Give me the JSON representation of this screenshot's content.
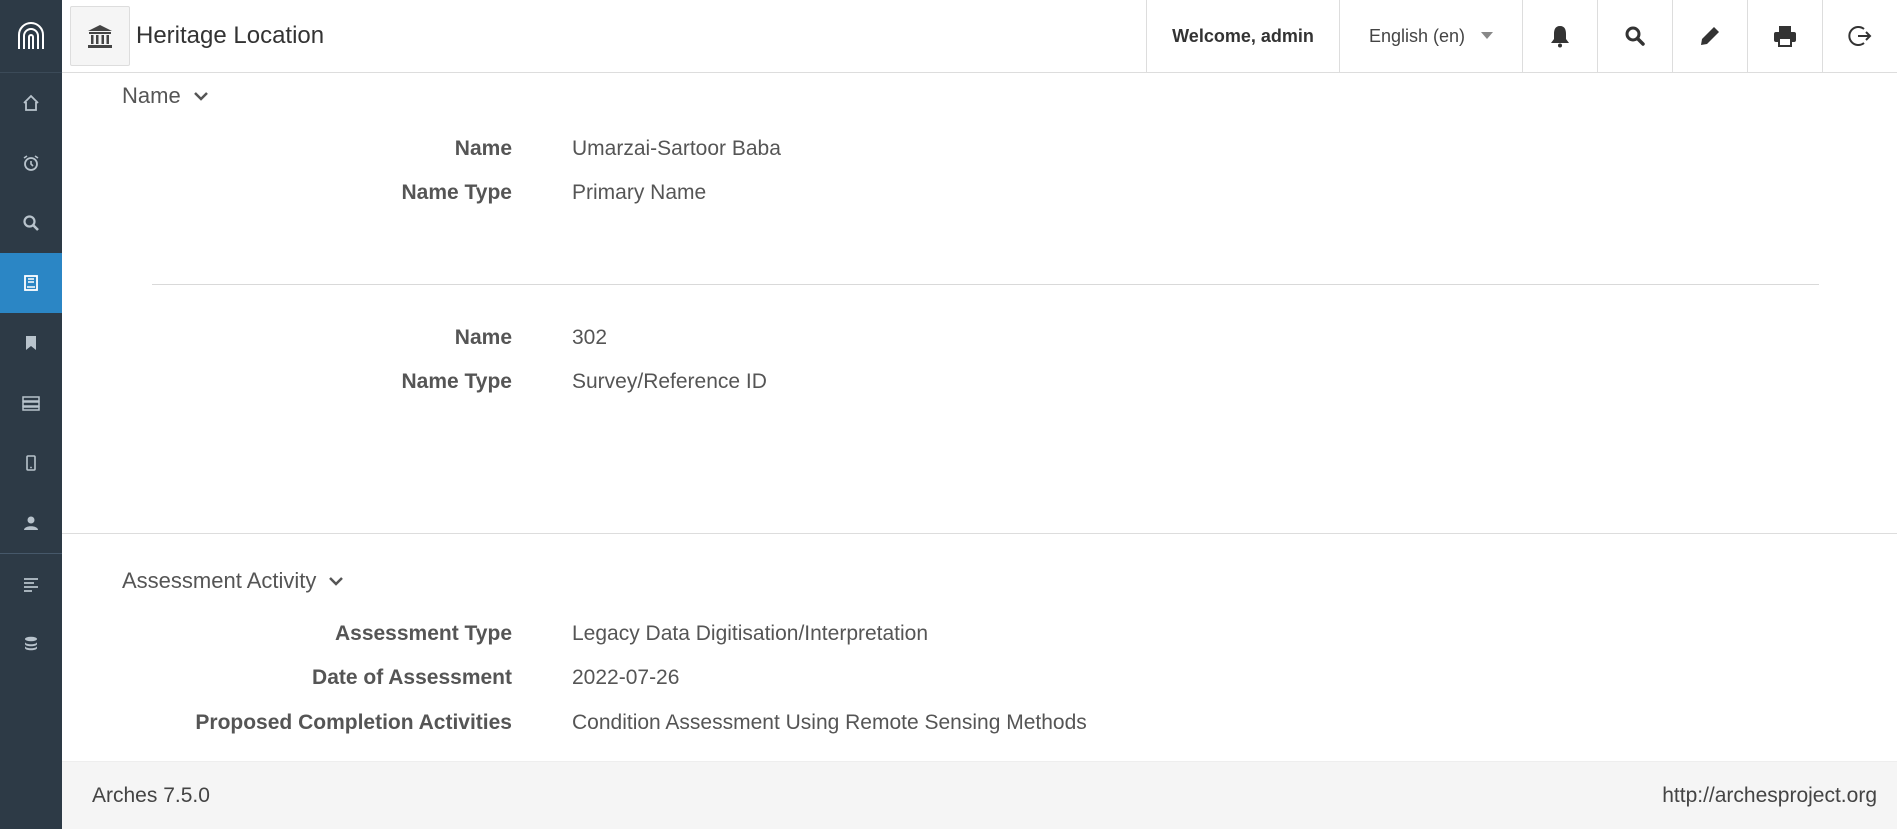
{
  "header": {
    "title": "Heritage Location",
    "welcome": "Welcome, admin",
    "language": "English (en)"
  },
  "sidebar": {
    "items": [
      {
        "icon": "home-icon"
      },
      {
        "icon": "alarm-clock-icon"
      },
      {
        "icon": "search-icon"
      },
      {
        "icon": "resource-editor-icon",
        "active": true
      },
      {
        "icon": "bookmark-icon"
      },
      {
        "icon": "server-icon"
      },
      {
        "icon": "mobile-icon"
      },
      {
        "icon": "user-icon"
      },
      {
        "icon": "list-icon"
      },
      {
        "icon": "database-icon"
      }
    ]
  },
  "sections": {
    "name": {
      "title": "Name",
      "entries": [
        {
          "name_label": "Name",
          "name_value": "Umarzai-Sartoor Baba",
          "type_label": "Name Type",
          "type_value": "Primary Name"
        },
        {
          "name_label": "Name",
          "name_value": "302",
          "type_label": "Name Type",
          "type_value": "Survey/Reference ID"
        }
      ]
    },
    "assessment": {
      "title": "Assessment Activity",
      "fields": [
        {
          "label": "Assessment Type",
          "value": "Legacy Data Digitisation/Interpretation"
        },
        {
          "label": "Date of Assessment",
          "value": "2022-07-26"
        },
        {
          "label": "Proposed Completion Activities",
          "value": "Condition Assessment Using Remote Sensing Methods"
        }
      ]
    }
  },
  "footer": {
    "version": "Arches 7.5.0",
    "url": "http://archesproject.org"
  },
  "colors": {
    "sidebar_bg": "#2d3a46",
    "active_item": "#2b86c5"
  }
}
